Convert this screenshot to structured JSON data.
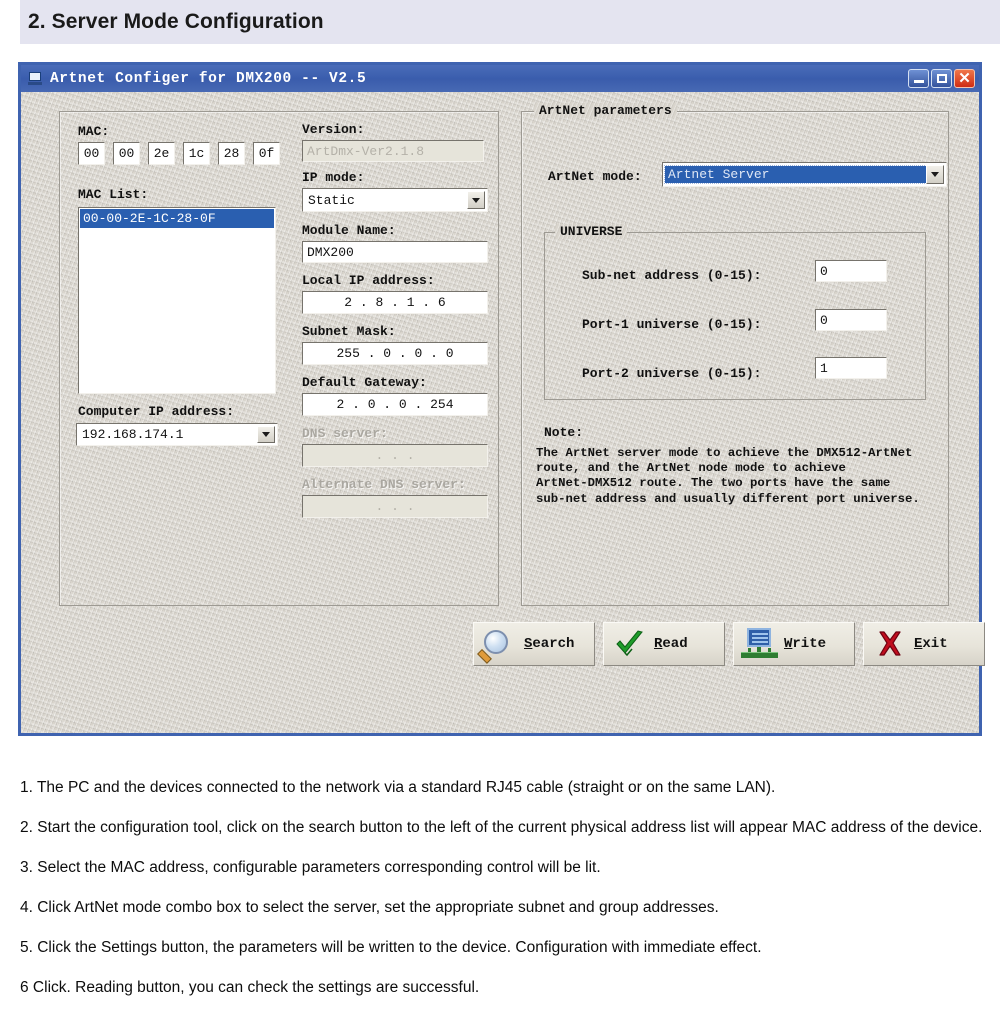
{
  "section": {
    "title": "2. Server Mode Configuration"
  },
  "window": {
    "title": "Artnet Configer for DMX200 -- V2.5",
    "title_icon": "monitor-icon",
    "controls": {
      "minimize": "_",
      "maximize": "□",
      "close": "✕"
    }
  },
  "left_panel": {
    "mac_label": "MAC:",
    "mac_octets": [
      "00",
      "00",
      "2e",
      "1c",
      "28",
      "0f"
    ],
    "mac_list_label": "MAC List:",
    "mac_list_items": [
      "00-00-2E-1C-28-0F"
    ],
    "computer_ip_label": "Computer IP address:",
    "computer_ip_value": "192.168.174.1"
  },
  "middle_panel": {
    "version_label": "Version:",
    "version_value": "ArtDmx-Ver2.1.8",
    "ip_mode_label": "IP mode:",
    "ip_mode_value": "Static",
    "module_name_label": "Module Name:",
    "module_name_value": "DMX200",
    "local_ip_label": "Local IP address:",
    "local_ip_value": "2  .  8  .  1  .  6",
    "subnet_mask_label": "Subnet Mask:",
    "subnet_mask_value": "255 .  0  .  0  .  0",
    "gateway_label": "Default Gateway:",
    "gateway_value": "2  .  0  .  0  . 254",
    "dns_label": "DNS server:",
    "dns_value": ".        .        .",
    "alt_dns_label": "Alternate DNS server:",
    "alt_dns_value": ".        .        ."
  },
  "artnet_panel": {
    "legend": "ArtNet parameters",
    "mode_label": "ArtNet mode:",
    "mode_value": "Artnet Server",
    "universe_legend": "UNIVERSE",
    "subnet_label": "Sub-net address (0-15):",
    "subnet_value": "0",
    "port1_label": "Port-1 universe (0-15):",
    "port1_value": "0",
    "port2_label": "Port-2 universe (0-15):",
    "port2_value": "1",
    "note_label": "Note:",
    "note_body": "The ArtNet server mode to achieve the DMX512-ArtNet\nroute, and the ArtNet node mode to achieve\nArtNet-DMX512 route. The two ports have the same\nsub-net address and usually different port universe."
  },
  "buttons": [
    {
      "name": "search",
      "label_pre": "",
      "accel": "S",
      "label_post": "earch",
      "icon": "magnifier-icon"
    },
    {
      "name": "read",
      "label_pre": "",
      "accel": "R",
      "label_post": "ead",
      "icon": "green-check-icon"
    },
    {
      "name": "write",
      "label_pre": "",
      "accel": "W",
      "label_post": "rite",
      "icon": "network-monitor-icon"
    },
    {
      "name": "exit",
      "label_pre": "",
      "accel": "E",
      "label_post": "xit",
      "icon": "red-x-icon"
    }
  ],
  "instructions": [
    "1. The PC and the devices connected to the network via a standard RJ45 cable (straight or on the same LAN).",
    "2. Start the configuration tool, click on the search button to the left of the current physical address list will appear MAC address of the device.",
    "3. Select the MAC address, configurable parameters corresponding control will be lit.",
    "4. Click  ArtNet mode combo box to select the server, set the appropriate subnet and group addresses.",
    "5. Click the Settings button, the parameters will be written to the device. Configuration with immediate effect.",
    "6 Click. Reading button, you can check the settings are successful."
  ],
  "colors": {
    "titlebar": "#3b5eae",
    "banner": "#e4e4f0",
    "selection": "#2a5fb0",
    "client_bg": "#d9d5cd",
    "close_button": "#cf2c13"
  }
}
